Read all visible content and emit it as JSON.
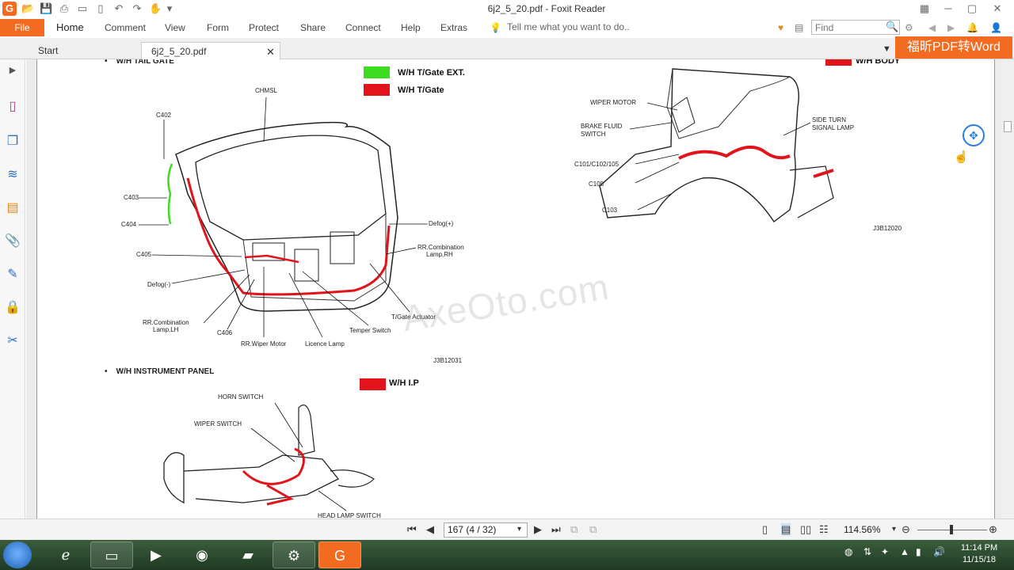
{
  "window": {
    "title": "6j2_5_20.pdf - Foxit Reader",
    "app_icon": "G"
  },
  "quick_access": {
    "icons": [
      "open-icon",
      "save-icon",
      "print-icon",
      "undo-icon",
      "redo-icon",
      "hand-tool-icon"
    ]
  },
  "menu": {
    "file": "File",
    "items": [
      "Home",
      "Comment",
      "View",
      "Form",
      "Protect",
      "Share",
      "Connect",
      "Help",
      "Extras"
    ],
    "tell_me": "Tell me what you want to do..",
    "find_placeholder": "Find"
  },
  "promo": {
    "label": "福昕PDF转Word"
  },
  "tabs": {
    "start": "Start",
    "doc": "6j2_5_20.pdf"
  },
  "document": {
    "section_tailgate": "W/H TAIL GATE",
    "section_instrument": "W/H INSTRUMENT PANEL",
    "legend_tgate_ext": "W/H T/Gate EXT.",
    "legend_tgate": "W/H T/Gate",
    "legend_body": "W/H BODY",
    "legend_ip": "W/H I.P",
    "code_tailgate": "J3B12031",
    "code_body": "J3B12020",
    "watermark": "AxeOto.com",
    "tailgate_labels": {
      "chmsl": "CHMSL",
      "c402": "C402",
      "c403": "C403",
      "c404": "C404",
      "c405": "C405",
      "defog_neg": "Defog(-)",
      "rr_comb_lh_1": "RR.Combination",
      "rr_comb_lh_2": "Lamp,LH",
      "c406": "C406",
      "rr_wiper": "RR.Wiper Motor",
      "licence": "Licence Lamp",
      "temper": "Temper Switch",
      "actuator": "T/Gate Actuator",
      "rr_comb_rh_1": "RR.Combination",
      "rr_comb_rh_2": "Lamp,RH",
      "defog_pos": "Defog(+)"
    },
    "body_labels": {
      "wiper_motor": "WIPER MOTOR",
      "brake_1": "BRAKE FLUID",
      "brake_2": "SWITCH",
      "c101": "C101/C102/105",
      "c108": "C108",
      "c103": "C103",
      "side_1": "SIDE TURN",
      "side_2": "SIGNAL LAMP"
    },
    "ip_labels": {
      "horn": "HORN SWITCH",
      "wiper": "WIPER SWITCH",
      "head": "HEAD LAMP SWITCH"
    }
  },
  "status": {
    "page_field": "167 (4 / 32)",
    "zoom": "114.56%"
  },
  "taskbar": {
    "time": "11:14 PM",
    "date": "11/15/18"
  },
  "colors": {
    "accent": "#f26b21",
    "wire_green": "#3ddc1f",
    "wire_red": "#e2131a"
  }
}
